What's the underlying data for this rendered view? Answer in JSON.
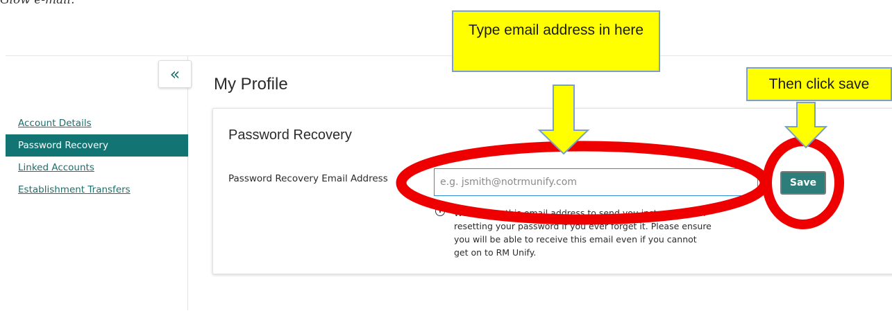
{
  "doc": {
    "caption_fragment": "Glow e-mail."
  },
  "sidebar": {
    "collapse_icon": "«",
    "items": [
      {
        "label": "Account Details",
        "active": false
      },
      {
        "label": "Password Recovery",
        "active": true
      },
      {
        "label": "Linked Accounts",
        "active": false
      },
      {
        "label": "Establishment Transfers",
        "active": false
      }
    ]
  },
  "main": {
    "page_title": "My Profile",
    "card": {
      "title": "Password Recovery",
      "field_label": "Password Recovery Email Address",
      "email_value": "",
      "email_placeholder": "e.g. jsmith@notrmunify.com",
      "save_label": "Save",
      "info_icon": "info-icon",
      "help_text": "We will use this email address to send you instructions on resetting your password if you ever forget it. Please ensure you will be able to receive this email even if you cannot get on to RM Unify."
    }
  },
  "annotations": {
    "callout_1": "Type email address in here",
    "callout_2": "Then click save",
    "callout_color": "#ffff00",
    "ring_color": "#ee0000"
  },
  "colors": {
    "accent": "#127574",
    "link": "#1d6e6c",
    "input_border": "#2b8fd6"
  }
}
